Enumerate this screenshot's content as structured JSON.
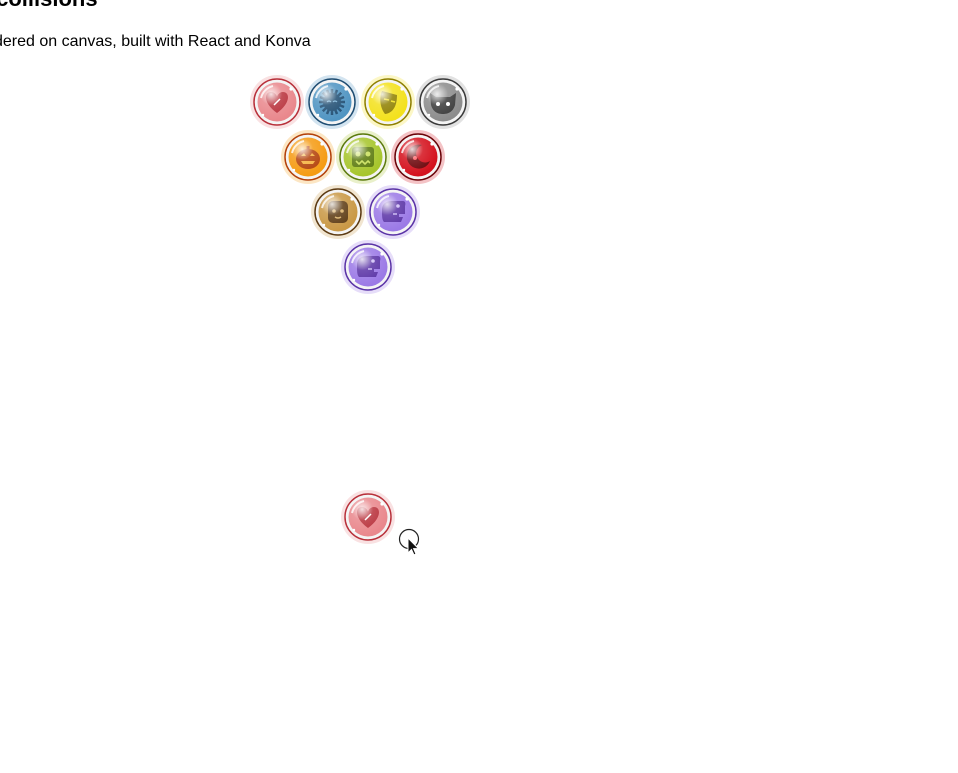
{
  "page": {
    "title": "istic collisions",
    "subtitle": "dered on canvas, built with React and Konva"
  },
  "game": {
    "bubbles": [
      {
        "color": "#e9878c",
        "dark": "#b8303a",
        "icon": "heart-icon"
      },
      {
        "color": "#4f94c2",
        "dark": "#1f4d72",
        "icon": "sun-face-icon"
      },
      {
        "color": "#f3e11c",
        "dark": "#8f8000",
        "icon": "mask-icon"
      },
      {
        "color": "#8c8c8c",
        "dark": "#3a3a3a",
        "icon": "cat-icon"
      },
      {
        "color": "#f59b13",
        "dark": "#b3410a",
        "icon": "pumpkin-icon"
      },
      {
        "color": "#a6c52b",
        "dark": "#5b7a0d",
        "icon": "monster-icon"
      },
      {
        "color": "#d4101c",
        "dark": "#6a0308",
        "icon": "moon-icon"
      },
      {
        "color": "#c99845",
        "dark": "#5c3a12",
        "icon": "ghost-icon"
      },
      {
        "color": "#9b79e6",
        "dark": "#5a33a6",
        "icon": "dinosaur-icon"
      },
      {
        "color": "#9b79e6",
        "dark": "#5a33a6",
        "icon": "dinosaur-icon"
      },
      {
        "color": "#e9878c",
        "dark": "#b8303a",
        "icon": "heart-icon"
      }
    ],
    "cursor": "pointer-cursor-icon"
  }
}
